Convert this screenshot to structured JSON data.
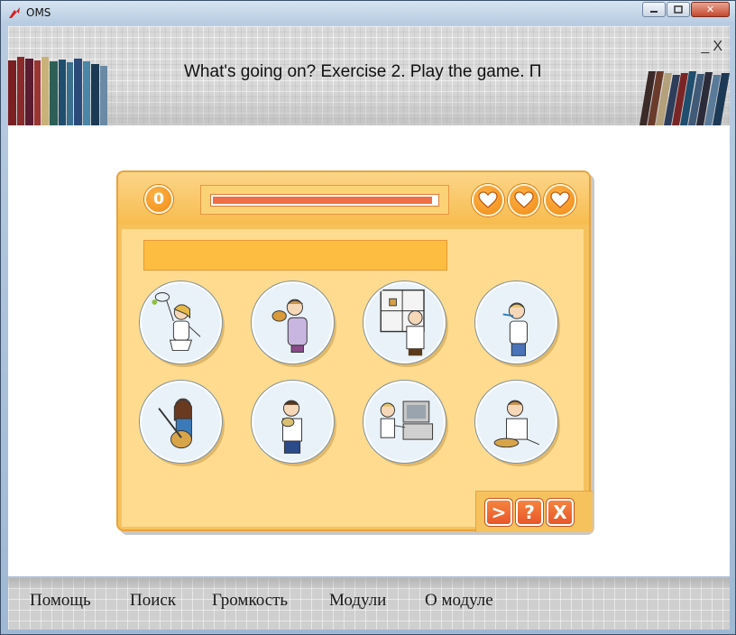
{
  "window": {
    "title": "OMS",
    "minimize_label": "▭",
    "maximize_label": "▢",
    "close_label": "✕"
  },
  "header": {
    "title": "What's going on? Exercise 2. Play the game. П",
    "mini_minimize": "_",
    "mini_close": "X"
  },
  "game": {
    "score": "0",
    "progress_fraction": 0.98,
    "lives": 3,
    "answer_text": "",
    "pictures": [
      {
        "icon": "girl-playing-tennis-icon"
      },
      {
        "icon": "boy-eating-sandwich-icon"
      },
      {
        "icon": "man-cleaning-window-icon"
      },
      {
        "icon": "boy-brushing-teeth-icon"
      },
      {
        "icon": "girl-playing-guitar-icon"
      },
      {
        "icon": "man-washing-face-icon"
      },
      {
        "icon": "boy-using-computer-icon"
      },
      {
        "icon": "man-making-food-icon"
      }
    ],
    "controls": {
      "next": ">",
      "help": "?",
      "close": "X"
    }
  },
  "bottom_menu": {
    "items": [
      "Помощь",
      "Поиск",
      "Громкость",
      "Модули",
      "О модуле"
    ]
  },
  "colors": {
    "game_bg": "#f6c25d",
    "inner_bg": "#fedb8e",
    "accent_orange": "#f08a14",
    "progress": "#ee6e45",
    "control_btn": "#e8562a"
  }
}
